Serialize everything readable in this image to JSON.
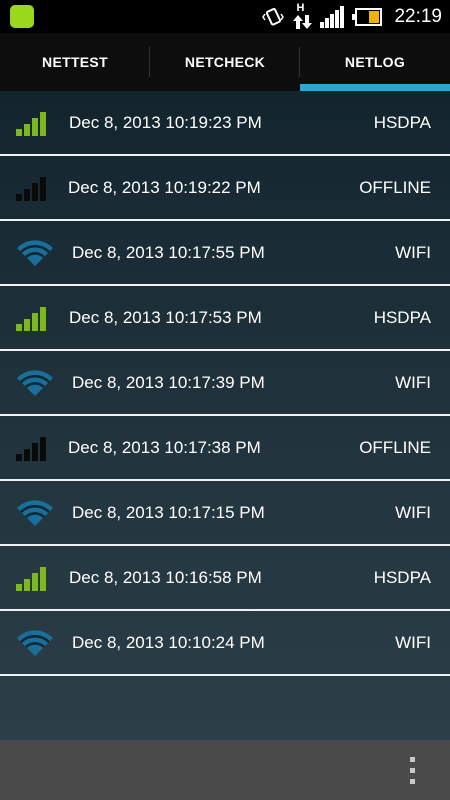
{
  "status_bar": {
    "time": "22:19",
    "network_letter": "H",
    "app_icon_color": "#9ad81c",
    "battery_color": "#f0b400",
    "icons": [
      "vibrate-icon",
      "data-transfer-icon",
      "signal-icon",
      "battery-icon"
    ]
  },
  "tabs": [
    {
      "label": "NETTEST",
      "active": false
    },
    {
      "label": "NETCHECK",
      "active": false
    },
    {
      "label": "NETLOG",
      "active": true
    }
  ],
  "accent_color": "#2ea5d8",
  "signal_green": "#7db81f",
  "log_entries": [
    {
      "time": "Dec 8, 2013 10:19:23 PM",
      "type": "HSDPA",
      "icon": "cell-signal-icon"
    },
    {
      "time": "Dec 8, 2013 10:19:22 PM",
      "type": "OFFLINE",
      "icon": "no-signal-icon"
    },
    {
      "time": "Dec 8, 2013 10:17:55 PM",
      "type": "WIFI",
      "icon": "wifi-icon"
    },
    {
      "time": "Dec 8, 2013 10:17:53 PM",
      "type": "HSDPA",
      "icon": "cell-signal-icon"
    },
    {
      "time": "Dec 8, 2013 10:17:39 PM",
      "type": "WIFI",
      "icon": "wifi-icon"
    },
    {
      "time": "Dec 8, 2013 10:17:38 PM",
      "type": "OFFLINE",
      "icon": "no-signal-icon"
    },
    {
      "time": "Dec 8, 2013 10:17:15 PM",
      "type": "WIFI",
      "icon": "wifi-icon"
    },
    {
      "time": "Dec 8, 2013 10:16:58 PM",
      "type": "HSDPA",
      "icon": "cell-signal-icon"
    },
    {
      "time": "Dec 8, 2013 10:10:24 PM",
      "type": "WIFI",
      "icon": "wifi-icon"
    }
  ],
  "bottom_bar": {
    "menu_icon": "overflow-menu-icon"
  }
}
